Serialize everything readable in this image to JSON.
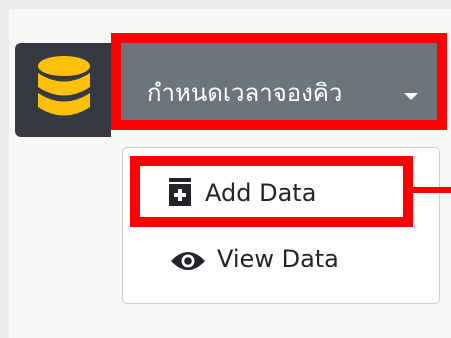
{
  "brand": {
    "icon": "database-icon",
    "icon_color": "#ffc107",
    "tile_color": "#343a40"
  },
  "menu": {
    "label": "กำหนดเวลาจองคิว",
    "caret_icon": "caret-down-icon",
    "button_color": "#6c757d"
  },
  "dropdown": {
    "items": [
      {
        "label": "Add Data",
        "icon": "file-add-icon"
      },
      {
        "label": "View Data",
        "icon": "eye-icon"
      }
    ]
  },
  "annotations": {
    "highlight_color": "#ff0000"
  }
}
